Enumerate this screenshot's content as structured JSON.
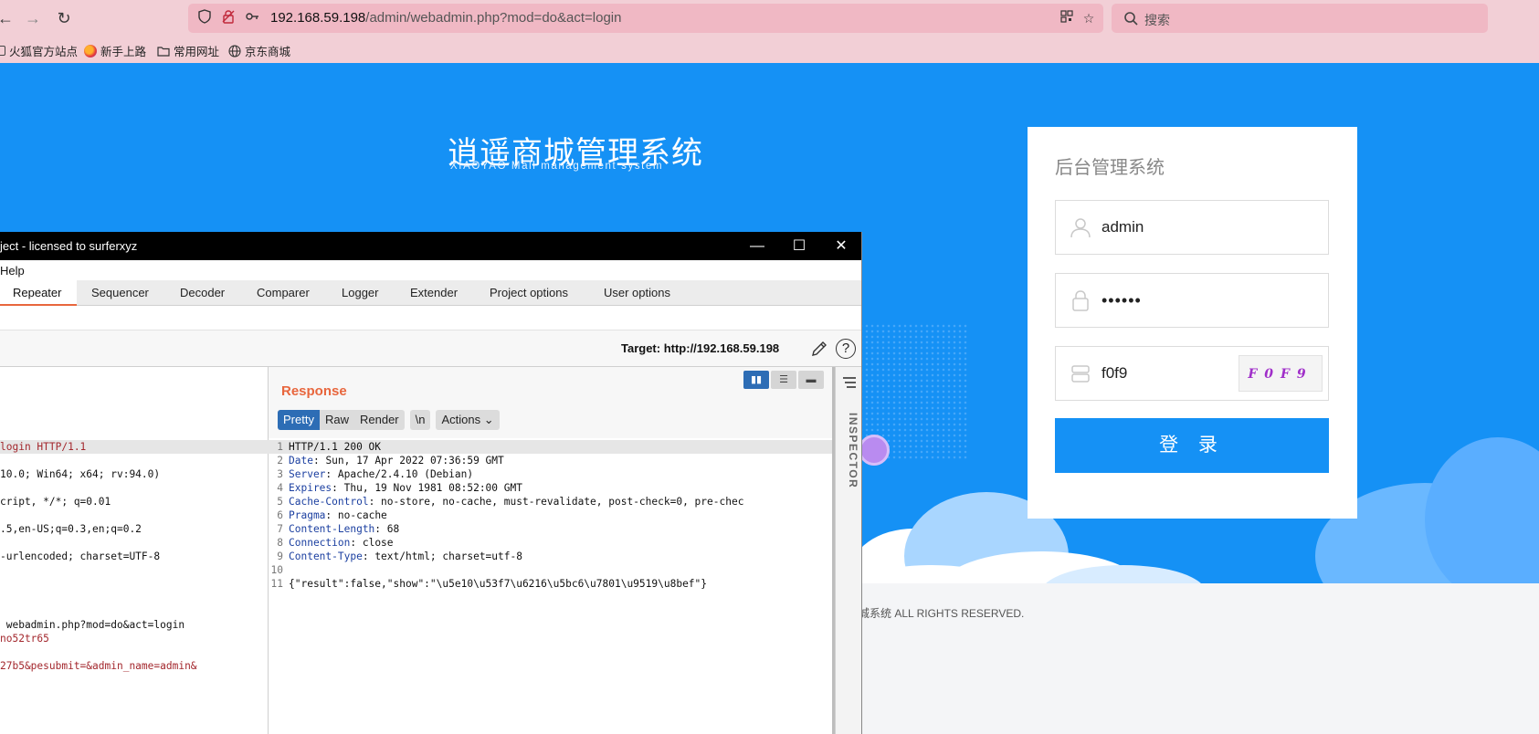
{
  "browser": {
    "url_host": "192.168.59.198",
    "url_path": "/admin/webadmin.php?mod=do&act=login",
    "search_placeholder": "搜索",
    "bookmarks": [
      "火狐官方站点",
      "新手上路",
      "常用网址",
      "京东商城"
    ]
  },
  "page": {
    "brand_title": "逍遥商城管理系统",
    "brand_subtitle": "XIAOYAO Mall management system",
    "login_title": "后台管理系统",
    "username_value": "admin",
    "password_value": "••••••",
    "captcha_value": "f0f9",
    "captcha_image_text": "F0F9",
    "login_button": "登 录",
    "footer": "城系统 ALL RIGHTS RESERVED.",
    "colors": {
      "brand_blue": "#1591f5",
      "burp_orange": "#e8663d"
    }
  },
  "burp": {
    "window_title": "ject - licensed to surferxyz",
    "menu_help": "Help",
    "tabs": [
      "Repeater",
      "Sequencer",
      "Decoder",
      "Comparer",
      "Logger",
      "Extender",
      "Project options",
      "User options"
    ],
    "active_tab": "Repeater",
    "target": "Target: http://192.168.59.198",
    "response_title": "Response",
    "view_buttons": [
      "Pretty",
      "Raw",
      "Render",
      "\\n",
      "Actions"
    ],
    "request_lines": [
      "login HTTP/1.1",
      "",
      "10.0; Win64; x64; rv:94.0)",
      "",
      "cript, */*; q=0.01",
      "",
      ".5,en-US;q=0.3,en;q=0.2",
      "",
      "-urlencoded; charset=UTF-8",
      "",
      "",
      "",
      "",
      " webadmin.php?mod=do&act=login",
      "no52tr65",
      "",
      "27b5&pesubmit=&admin_name=admin&"
    ],
    "response_lines": [
      {
        "n": "1",
        "key": "",
        "val": "HTTP/1.1 200 OK"
      },
      {
        "n": "2",
        "key": "Date",
        "val": " Sun, 17 Apr 2022 07:36:59 GMT"
      },
      {
        "n": "3",
        "key": "Server",
        "val": " Apache/2.4.10 (Debian)"
      },
      {
        "n": "4",
        "key": "Expires",
        "val": " Thu, 19 Nov 1981 08:52:00 GMT"
      },
      {
        "n": "5",
        "key": "Cache-Control",
        "val": " no-store, no-cache, must-revalidate, post-check=0, pre-chec"
      },
      {
        "n": "6",
        "key": "Pragma",
        "val": " no-cache"
      },
      {
        "n": "7",
        "key": "Content-Length",
        "val": " 68"
      },
      {
        "n": "8",
        "key": "Connection",
        "val": " close"
      },
      {
        "n": "9",
        "key": "Content-Type",
        "val": " text/html; charset=utf-8"
      },
      {
        "n": "10",
        "key": "",
        "val": ""
      },
      {
        "n": "11",
        "key": "",
        "val": "{\"result\":false,\"show\":\"\\u5e10\\u53f7\\u6216\\u5bc6\\u7801\\u9519\\u8bef\"}"
      }
    ],
    "inspector_label": "INSPECTOR"
  }
}
